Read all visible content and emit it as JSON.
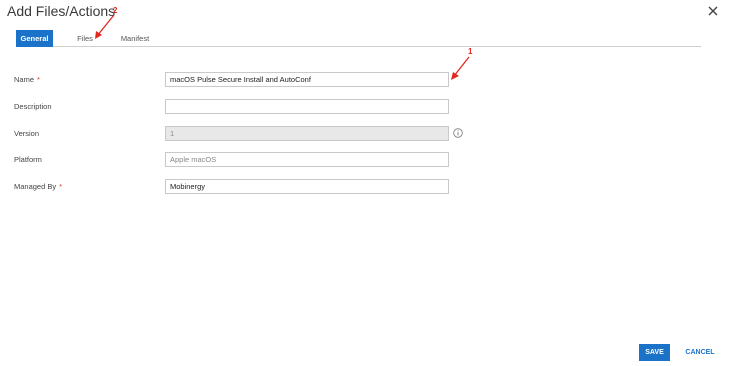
{
  "dialog": {
    "title": "Add Files/Actions"
  },
  "tabs": [
    {
      "label": "General"
    },
    {
      "label": "Files"
    },
    {
      "label": "Manifest"
    }
  ],
  "form": {
    "name": {
      "label": "Name",
      "required_mark": "*",
      "value": "macOS Pulse Secure Install and AutoConf"
    },
    "description": {
      "label": "Description",
      "value": ""
    },
    "version": {
      "label": "Version",
      "value": "1"
    },
    "platform": {
      "label": "Platform",
      "value": "Apple macOS"
    },
    "managed_by": {
      "label": "Managed By",
      "required_mark": "*",
      "value": "Mobinergy"
    }
  },
  "annotations": {
    "num1": "1",
    "num2": "2",
    "color": "#e0281f"
  },
  "actions": {
    "save_label": "SAVE",
    "cancel_label": "CANCEL"
  },
  "colors": {
    "accent": "#1a73c9",
    "required": "#d9302c"
  },
  "icons": {
    "close": "close-icon",
    "info": "info-icon"
  }
}
